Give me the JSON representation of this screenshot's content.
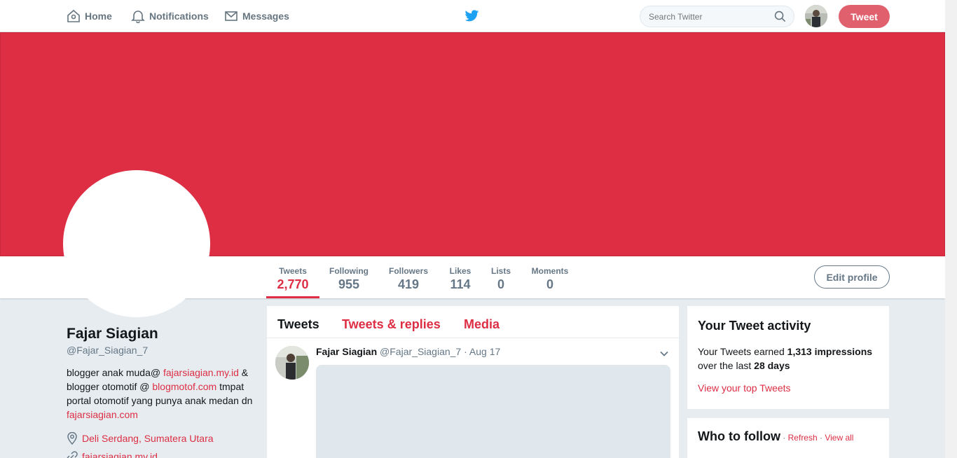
{
  "nav": {
    "home": "Home",
    "notifications": "Notifications",
    "messages": "Messages",
    "search_placeholder": "Search Twitter",
    "tweet": "Tweet"
  },
  "profile": {
    "name": "Fajar Siagian",
    "handle": "@Fajar_Siagian_7",
    "bio": {
      "t1": "blogger anak muda@ ",
      "l1": "fajarsiagian.my.id",
      "t2": " & blogger otomotif @ ",
      "l2": "blogmotof.com",
      "t3": " tmpat portal otomotif yang punya anak medan dn ",
      "l3": "fajarsiagian.com"
    },
    "location": "Deli Serdang, Sumatera Utara",
    "website": "fajarsiagian.my.id"
  },
  "stats": [
    {
      "label": "Tweets",
      "value": "2,770"
    },
    {
      "label": "Following",
      "value": "955"
    },
    {
      "label": "Followers",
      "value": "419"
    },
    {
      "label": "Likes",
      "value": "114"
    },
    {
      "label": "Lists",
      "value": "0"
    },
    {
      "label": "Moments",
      "value": "0"
    }
  ],
  "edit_profile": "Edit profile",
  "timeline": {
    "tabs": [
      "Tweets",
      "Tweets & replies",
      "Media"
    ],
    "tweet": {
      "name": "Fajar Siagian",
      "handle": "@Fajar_Siagian_7",
      "sep": " · ",
      "date": "Aug 17"
    }
  },
  "activity": {
    "title": "Your Tweet activity",
    "t1": "Your Tweets earned ",
    "impressions": "1,313 impressions",
    "t2": " over the last ",
    "days": "28 days",
    "link": "View your top Tweets"
  },
  "who_to_follow": {
    "title": "Who to follow",
    "dot": " · ",
    "refresh": "Refresh",
    "view_all": "View all"
  },
  "colors": {
    "accent": "#dd2e44",
    "banner": "#dd2e44",
    "muted": "#657786"
  }
}
